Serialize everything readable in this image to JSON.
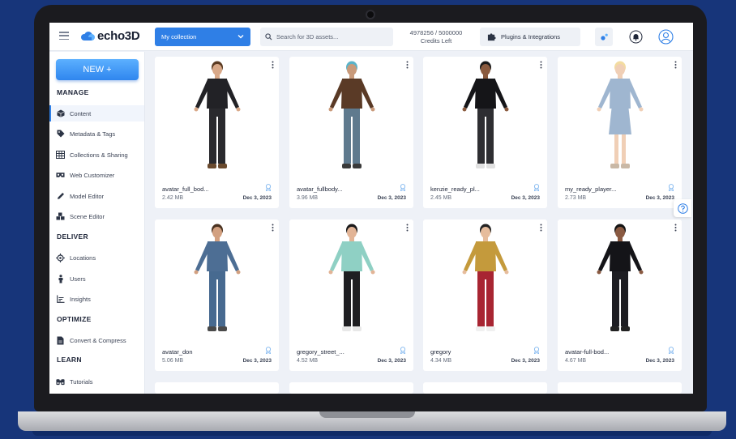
{
  "header": {
    "logo_text": "echo3D",
    "collection_label": "My collection",
    "search_placeholder": "Search for 3D assets...",
    "credits_value": "4978256 / 5000000",
    "credits_label": "Credits Left",
    "plugins_label": "Plugins & Integrations"
  },
  "sidebar": {
    "new_label": "NEW +",
    "sections": {
      "manage": "MANAGE",
      "deliver": "DELIVER",
      "optimize": "OPTIMIZE",
      "learn": "LEARN"
    },
    "items": {
      "content": "Content",
      "metadata": "Metadata & Tags",
      "collections": "Collections & Sharing",
      "web_customizer": "Web Customizer",
      "model_editor": "Model Editor",
      "scene_editor": "Scene Editor",
      "locations": "Locations",
      "users": "Users",
      "insights": "Insights",
      "convert": "Convert & Compress",
      "tutorials": "Tutorials"
    }
  },
  "assets": [
    {
      "name": "avatar_full_bod...",
      "size": "2.42 MB",
      "date": "Dec 3, 2023"
    },
    {
      "name": "avatar_fullbody...",
      "size": "3.96 MB",
      "date": "Dec 3, 2023"
    },
    {
      "name": "kenzie_ready_pl...",
      "size": "2.45 MB",
      "date": "Dec 3, 2023"
    },
    {
      "name": "my_ready_player...",
      "size": "2.73 MB",
      "date": "Dec 3, 2023"
    },
    {
      "name": "avatar_don",
      "size": "5.06 MB",
      "date": "Dec 3, 2023"
    },
    {
      "name": "gregory_street_...",
      "size": "4.52 MB",
      "date": "Dec 3, 2023"
    },
    {
      "name": "gregory",
      "size": "4.34 MB",
      "date": "Dec 3, 2023"
    },
    {
      "name": "avatar-full-bod...",
      "size": "4.67 MB",
      "date": "Dec 3, 2023"
    }
  ],
  "colors": {
    "accent": "#2f7fe6",
    "background": "#17357a"
  }
}
